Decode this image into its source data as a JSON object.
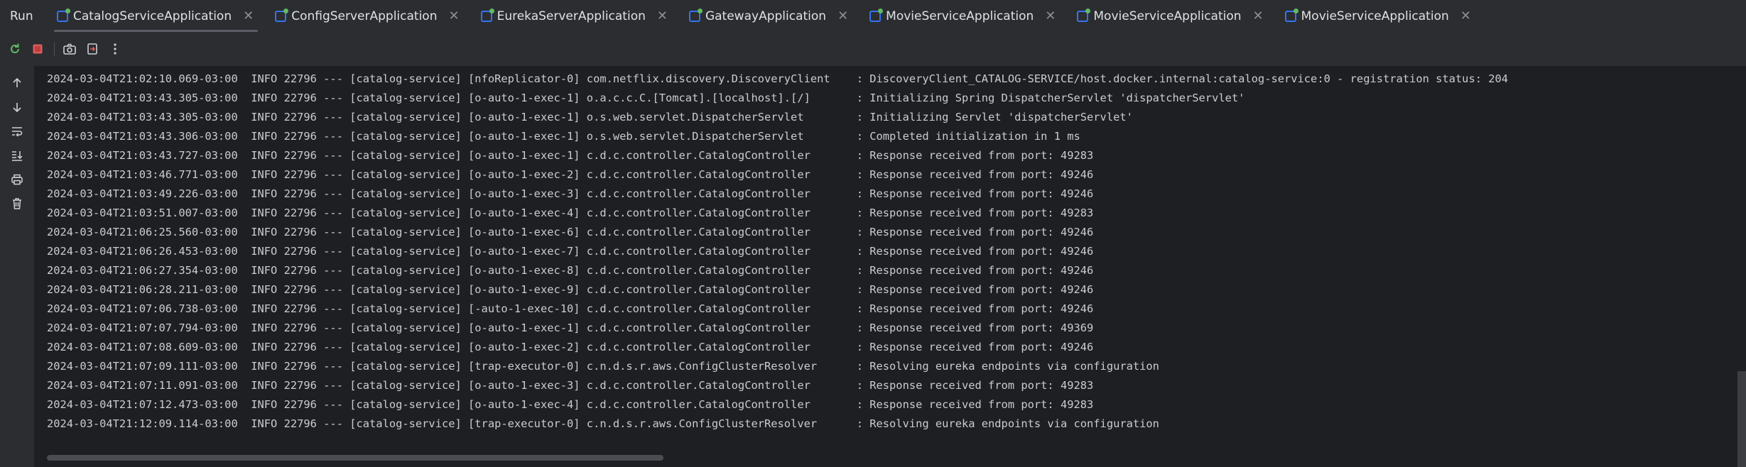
{
  "run_label": "Run",
  "tabs": [
    {
      "label": "CatalogServiceApplication",
      "active": true,
      "running": true
    },
    {
      "label": "ConfigServerApplication",
      "active": false,
      "running": true
    },
    {
      "label": "EurekaServerApplication",
      "active": false,
      "running": true
    },
    {
      "label": "GatewayApplication",
      "active": false,
      "running": true
    },
    {
      "label": "MovieServiceApplication",
      "active": false,
      "running": true
    },
    {
      "label": "MovieServiceApplication",
      "active": false,
      "running": true
    },
    {
      "label": "MovieServiceApplication",
      "active": false,
      "running": true
    }
  ],
  "tab_close_glyph": "✕",
  "toolbar_icons": [
    "rerun-icon",
    "stop-icon",
    "camera-icon",
    "exit-icon",
    "more-icon"
  ],
  "side_icons": [
    "arrow-up-icon",
    "arrow-down-icon",
    "soft-wrap-icon",
    "scroll-to-end-icon",
    "print-icon",
    "trash-icon"
  ],
  "colors": {
    "accent_blue": "#3574f0",
    "running_green": "#5fb865",
    "stop_red": "#db5c5c",
    "console_bg": "#1e1f22",
    "panel_bg": "#2b2d30"
  },
  "log_lines": [
    "2024-03-04T21:02:10.069-03:00  INFO 22796 --- [catalog-service] [nfoReplicator-0] com.netflix.discovery.DiscoveryClient    : DiscoveryClient_CATALOG-SERVICE/host.docker.internal:catalog-service:0 - registration status: 204",
    "2024-03-04T21:03:43.305-03:00  INFO 22796 --- [catalog-service] [o-auto-1-exec-1] o.a.c.c.C.[Tomcat].[localhost].[/]       : Initializing Spring DispatcherServlet 'dispatcherServlet'",
    "2024-03-04T21:03:43.305-03:00  INFO 22796 --- [catalog-service] [o-auto-1-exec-1] o.s.web.servlet.DispatcherServlet        : Initializing Servlet 'dispatcherServlet'",
    "2024-03-04T21:03:43.306-03:00  INFO 22796 --- [catalog-service] [o-auto-1-exec-1] o.s.web.servlet.DispatcherServlet        : Completed initialization in 1 ms",
    "2024-03-04T21:03:43.727-03:00  INFO 22796 --- [catalog-service] [o-auto-1-exec-1] c.d.c.controller.CatalogController       : Response received from port: 49283",
    "2024-03-04T21:03:46.771-03:00  INFO 22796 --- [catalog-service] [o-auto-1-exec-2] c.d.c.controller.CatalogController       : Response received from port: 49246",
    "2024-03-04T21:03:49.226-03:00  INFO 22796 --- [catalog-service] [o-auto-1-exec-3] c.d.c.controller.CatalogController       : Response received from port: 49246",
    "2024-03-04T21:03:51.007-03:00  INFO 22796 --- [catalog-service] [o-auto-1-exec-4] c.d.c.controller.CatalogController       : Response received from port: 49283",
    "2024-03-04T21:06:25.560-03:00  INFO 22796 --- [catalog-service] [o-auto-1-exec-6] c.d.c.controller.CatalogController       : Response received from port: 49246",
    "2024-03-04T21:06:26.453-03:00  INFO 22796 --- [catalog-service] [o-auto-1-exec-7] c.d.c.controller.CatalogController       : Response received from port: 49246",
    "2024-03-04T21:06:27.354-03:00  INFO 22796 --- [catalog-service] [o-auto-1-exec-8] c.d.c.controller.CatalogController       : Response received from port: 49246",
    "2024-03-04T21:06:28.211-03:00  INFO 22796 --- [catalog-service] [o-auto-1-exec-9] c.d.c.controller.CatalogController       : Response received from port: 49246",
    "2024-03-04T21:07:06.738-03:00  INFO 22796 --- [catalog-service] [-auto-1-exec-10] c.d.c.controller.CatalogController       : Response received from port: 49246",
    "2024-03-04T21:07:07.794-03:00  INFO 22796 --- [catalog-service] [o-auto-1-exec-1] c.d.c.controller.CatalogController       : Response received from port: 49369",
    "2024-03-04T21:07:08.609-03:00  INFO 22796 --- [catalog-service] [o-auto-1-exec-2] c.d.c.controller.CatalogController       : Response received from port: 49246",
    "2024-03-04T21:07:09.111-03:00  INFO 22796 --- [catalog-service] [trap-executor-0] c.n.d.s.r.aws.ConfigClusterResolver      : Resolving eureka endpoints via configuration",
    "2024-03-04T21:07:11.091-03:00  INFO 22796 --- [catalog-service] [o-auto-1-exec-3] c.d.c.controller.CatalogController       : Response received from port: 49283",
    "2024-03-04T21:07:12.473-03:00  INFO 22796 --- [catalog-service] [o-auto-1-exec-4] c.d.c.controller.CatalogController       : Response received from port: 49283",
    "2024-03-04T21:12:09.114-03:00  INFO 22796 --- [catalog-service] [trap-executor-0] c.n.d.s.r.aws.ConfigClusterResolver      : Resolving eureka endpoints via configuration"
  ]
}
